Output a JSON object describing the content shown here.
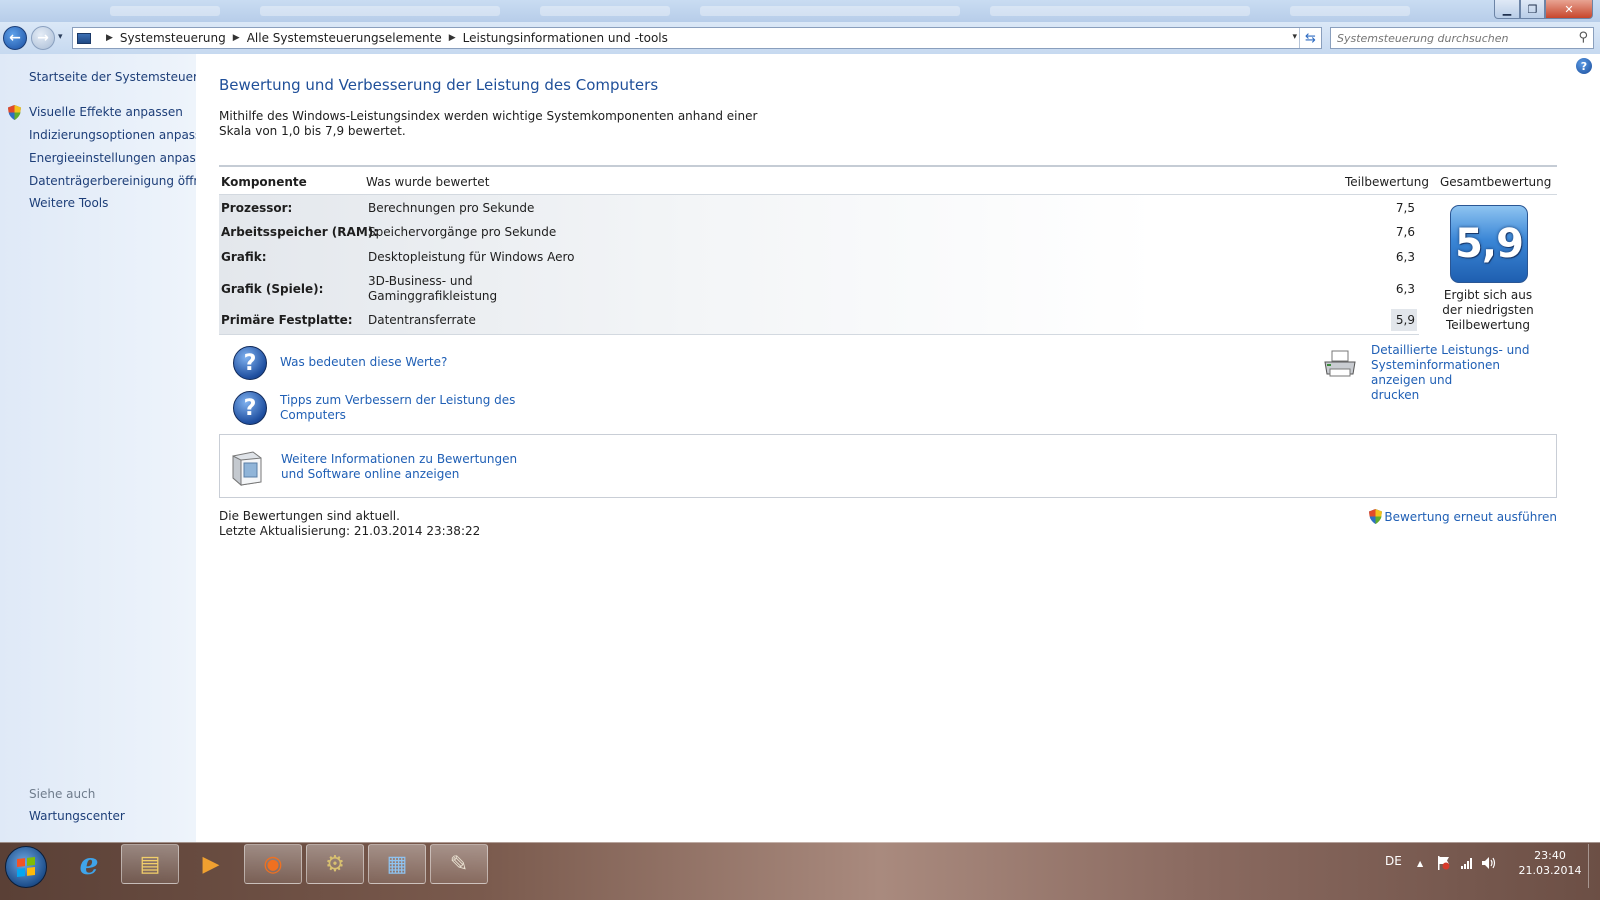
{
  "window": {
    "minimize_glyph": "▁",
    "maximize_glyph": "❐",
    "close_glyph": "✕"
  },
  "nav": {
    "back_glyph": "←",
    "forward_glyph": "→",
    "dropdown_glyph": "▾",
    "breadcrumbs": [
      "Systemsteuerung",
      "Alle Systemsteuerungselemente",
      "Leistungsinformationen und -tools"
    ],
    "crumb_sep": "▶",
    "refresh_glyph": "⇆",
    "search_placeholder": "Systemsteuerung durchsuchen",
    "search_glyph": "⚲"
  },
  "sidebar": {
    "home": "Startseite der Systemsteuerung",
    "items": [
      "Visuelle Effekte anpassen",
      "Indizierungsoptionen anpassen",
      "Energieeinstellungen anpassen",
      "Datenträgerbereinigung öffnen",
      "Weitere Tools"
    ],
    "see_also_title": "Siehe auch",
    "see_also_items": [
      "Wartungscenter"
    ]
  },
  "main": {
    "help_glyph": "?",
    "title": "Bewertung und Verbesserung der Leistung des Computers",
    "intro": "Mithilfe des Windows-Leistungsindex werden wichtige Systemkomponenten anhand einer Skala von 1,0 bis 7,9 bewertet.",
    "table": {
      "headers": {
        "component": "Komponente",
        "what": "Was wurde bewertet",
        "subscore": "Teilbewertung",
        "basescore": "Gesamtbewertung"
      },
      "rows": [
        {
          "component": "Prozessor:",
          "what": "Berechnungen pro Sekunde",
          "score": "7,5"
        },
        {
          "component": "Arbeitsspeicher (RAM):",
          "what": "Speichervorgänge pro Sekunde",
          "score": "7,6"
        },
        {
          "component": "Grafik:",
          "what": "Desktopleistung für Windows Aero",
          "score": "6,3"
        },
        {
          "component": "Grafik (Spiele):",
          "what_line1": "3D-Business- und",
          "what_line2": "Gaminggrafikleistung",
          "score": "6,3"
        },
        {
          "component": "Primäre Festplatte:",
          "what": "Datentransferrate",
          "score": "5,9"
        }
      ],
      "base_score": "5,9",
      "base_note_lines": [
        "Ergibt sich aus",
        "der niedrigsten",
        "Teilbewertung"
      ]
    },
    "links": {
      "q_glyph": "?",
      "meaning": "Was bedeuten diese Werte?",
      "tips_line1": "Tipps zum Verbessern der Leistung des",
      "tips_line2": "Computers",
      "details_line1": "Detaillierte Leistungs- und",
      "details_line2": "Systeminformationen anzeigen und",
      "details_line3": "drucken"
    },
    "info_box": {
      "line1": "Weitere Informationen zu Bewertungen",
      "line2": "und Software online anzeigen"
    },
    "status": {
      "line1": "Die Bewertungen sind aktuell.",
      "line2": "Letzte Aktualisierung: 21.03.2014 23:38:22"
    },
    "rerun": "Bewertung erneut ausführen"
  },
  "taskbar": {
    "apps": [
      {
        "name": "internet-explorer",
        "glyph": "ℯ",
        "color": "#3fa4ea"
      },
      {
        "name": "explorer",
        "glyph": "▤",
        "color": "#f2cf6a"
      },
      {
        "name": "media-player",
        "glyph": "▶",
        "color": "#f0a030"
      },
      {
        "name": "firefox",
        "glyph": "◉",
        "color": "#f07020"
      },
      {
        "name": "java-ee-ide",
        "glyph": "⚙",
        "color": "#d8c070"
      },
      {
        "name": "control-panel",
        "glyph": "▦",
        "color": "#8fc3f0"
      },
      {
        "name": "paint",
        "glyph": "✎",
        "color": "#e8e0d0"
      }
    ],
    "language": "DE",
    "tray_arrow": "▲",
    "time": "23:40",
    "date": "21.03.2014"
  }
}
